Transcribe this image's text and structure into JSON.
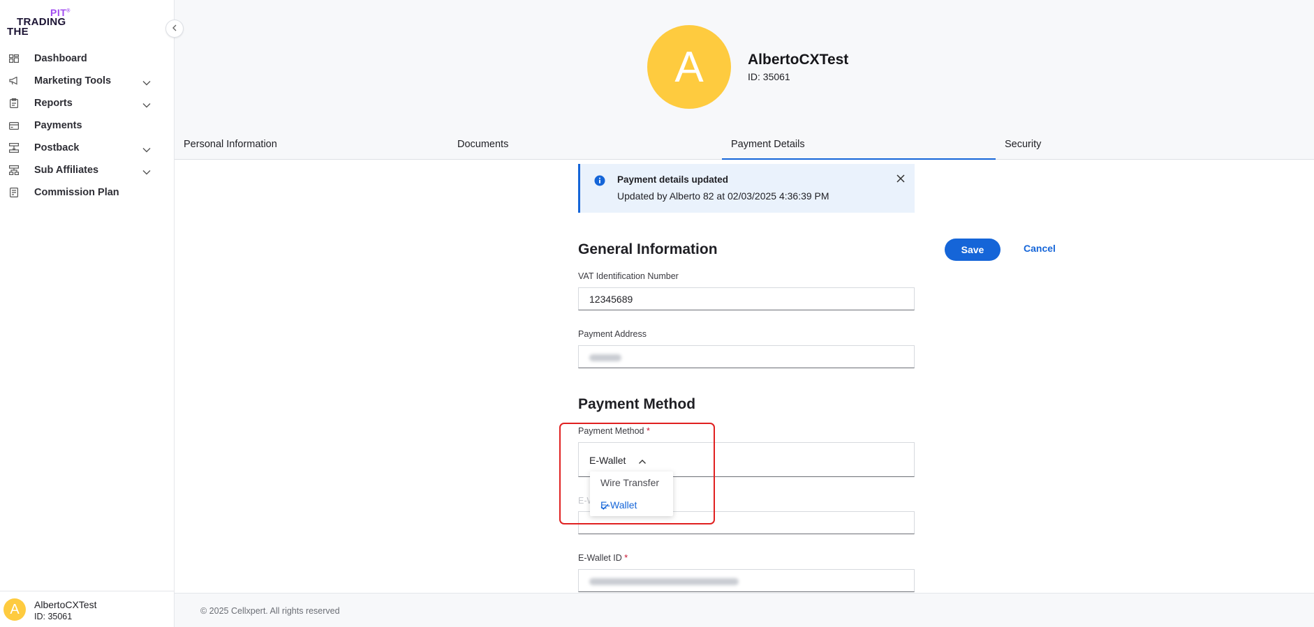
{
  "brand": {
    "logo_line1": "PIT",
    "logo_line2": "TRADING",
    "logo_line3": "THE",
    "accent_color": "#1565d8",
    "logo_purple": "#a24df0",
    "avatar_color": "#fecb3f"
  },
  "sidebar": {
    "items": [
      {
        "label": "Dashboard",
        "icon": "dashboard-icon",
        "has_submenu": false
      },
      {
        "label": "Marketing Tools",
        "icon": "megaphone-icon",
        "has_submenu": true
      },
      {
        "label": "Reports",
        "icon": "clipboard-icon",
        "has_submenu": true
      },
      {
        "label": "Payments",
        "icon": "card-icon",
        "has_submenu": false
      },
      {
        "label": "Postback",
        "icon": "postback-icon",
        "has_submenu": true
      },
      {
        "label": "Sub Affiliates",
        "icon": "hierarchy-icon",
        "has_submenu": true
      },
      {
        "label": "Commission Plan",
        "icon": "document-icon",
        "has_submenu": false
      }
    ],
    "user": {
      "avatar_letter": "A",
      "name": "AlbertoCXTest",
      "id": "ID: 35061"
    }
  },
  "profile": {
    "avatar_letter": "A",
    "name": "AlbertoCXTest",
    "id": "ID: 35061"
  },
  "tabs": [
    {
      "label": "Personal Information",
      "active": false
    },
    {
      "label": "Documents",
      "active": false
    },
    {
      "label": "Payment Details",
      "active": true
    },
    {
      "label": "Security",
      "active": false
    }
  ],
  "notice": {
    "title": "Payment details updated",
    "text": "Updated by Alberto 82 at 02/03/2025 4:36:39 PM"
  },
  "general": {
    "title": "General Information",
    "save_label": "Save",
    "cancel_label": "Cancel",
    "vat_label": "VAT Identification Number",
    "vat_value": "12345689",
    "address_label": "Payment Address"
  },
  "payment_method": {
    "title": "Payment Method",
    "field_label": "Payment Method",
    "required_mark": "*",
    "selected": "E-Wallet",
    "options": [
      "Wire Transfer",
      "E-Wallet"
    ],
    "ewallet_id_label": "E-Wallet ID"
  },
  "footer": {
    "copyright": "© 2025 Cellxpert. All rights reserved"
  }
}
